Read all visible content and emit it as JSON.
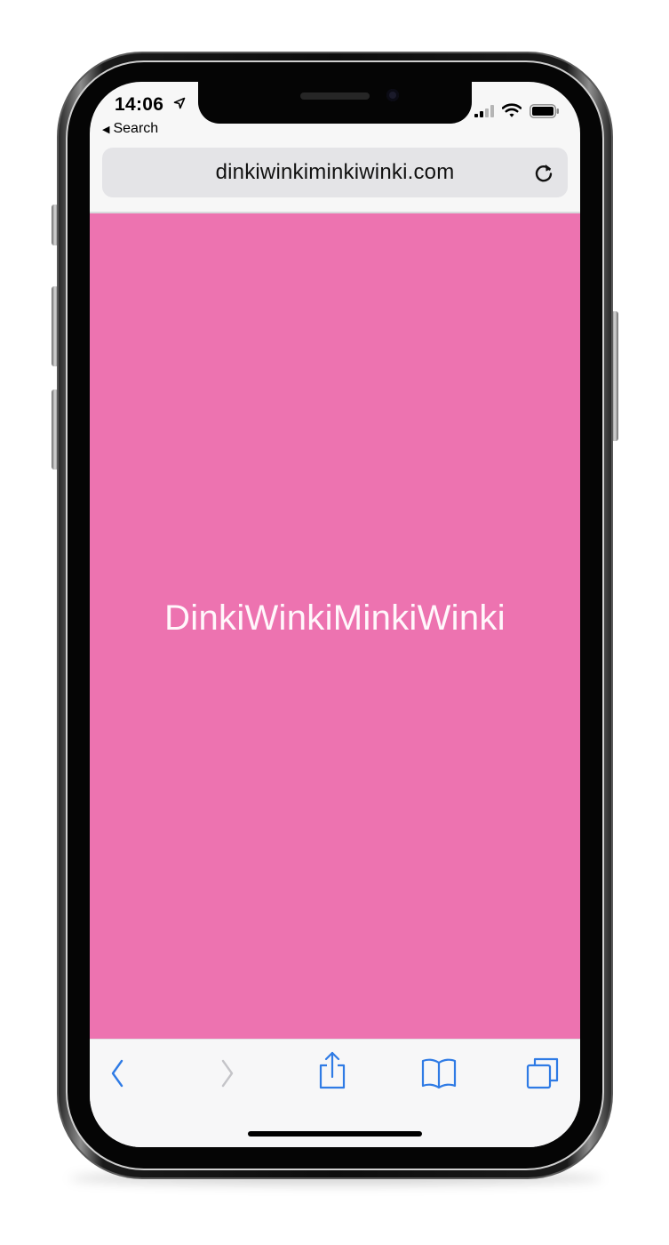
{
  "status_bar": {
    "time": "14:06",
    "back_app_label": "Search"
  },
  "browser": {
    "url": "dinkiwinkiminkiwinki.com"
  },
  "page": {
    "headline": "DinkiWinkiMinkiWinki",
    "background_color": "#ED73B0"
  },
  "toolbar": {
    "items": [
      "back-icon",
      "forward-icon",
      "share-icon",
      "bookmarks-icon",
      "tabs-icon"
    ],
    "accent_color": "#2F7BE5"
  }
}
